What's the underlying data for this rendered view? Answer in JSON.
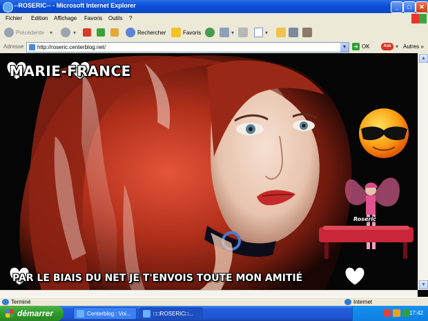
{
  "window": {
    "title": "▫▫ROSERIC▫▫ - Microsoft Internet Explorer",
    "controls": {
      "minimize": "_",
      "maximize": "□",
      "close": "✕"
    }
  },
  "menu": [
    "Fichier",
    "Edition",
    "Affichage",
    "Favoris",
    "Outils",
    "?"
  ],
  "toolbar": {
    "back_label": "Précédente",
    "search_label": "Rechercher",
    "favorites_label": "Favoris"
  },
  "address": {
    "label": "Adresse",
    "url": "http://roseric.centerblog.net/",
    "go_label": "OK",
    "ask_label": "Ask",
    "others_label": "Autres"
  },
  "page": {
    "top_text": "Marie-France",
    "bottom_text": "par le biais du net je t'envois toute mon amitié",
    "signature": "Roseric",
    "colors": {
      "hair": "#b8321c",
      "background": "#050505",
      "bench": "#c9263a"
    }
  },
  "status": {
    "left": "Terminé",
    "zone": "Internet"
  },
  "taskbar": {
    "start_label": "démarrer",
    "tasks": [
      "Centerblog : Voi...",
      "□□ROSERIC□..."
    ],
    "clock": "17:42"
  }
}
